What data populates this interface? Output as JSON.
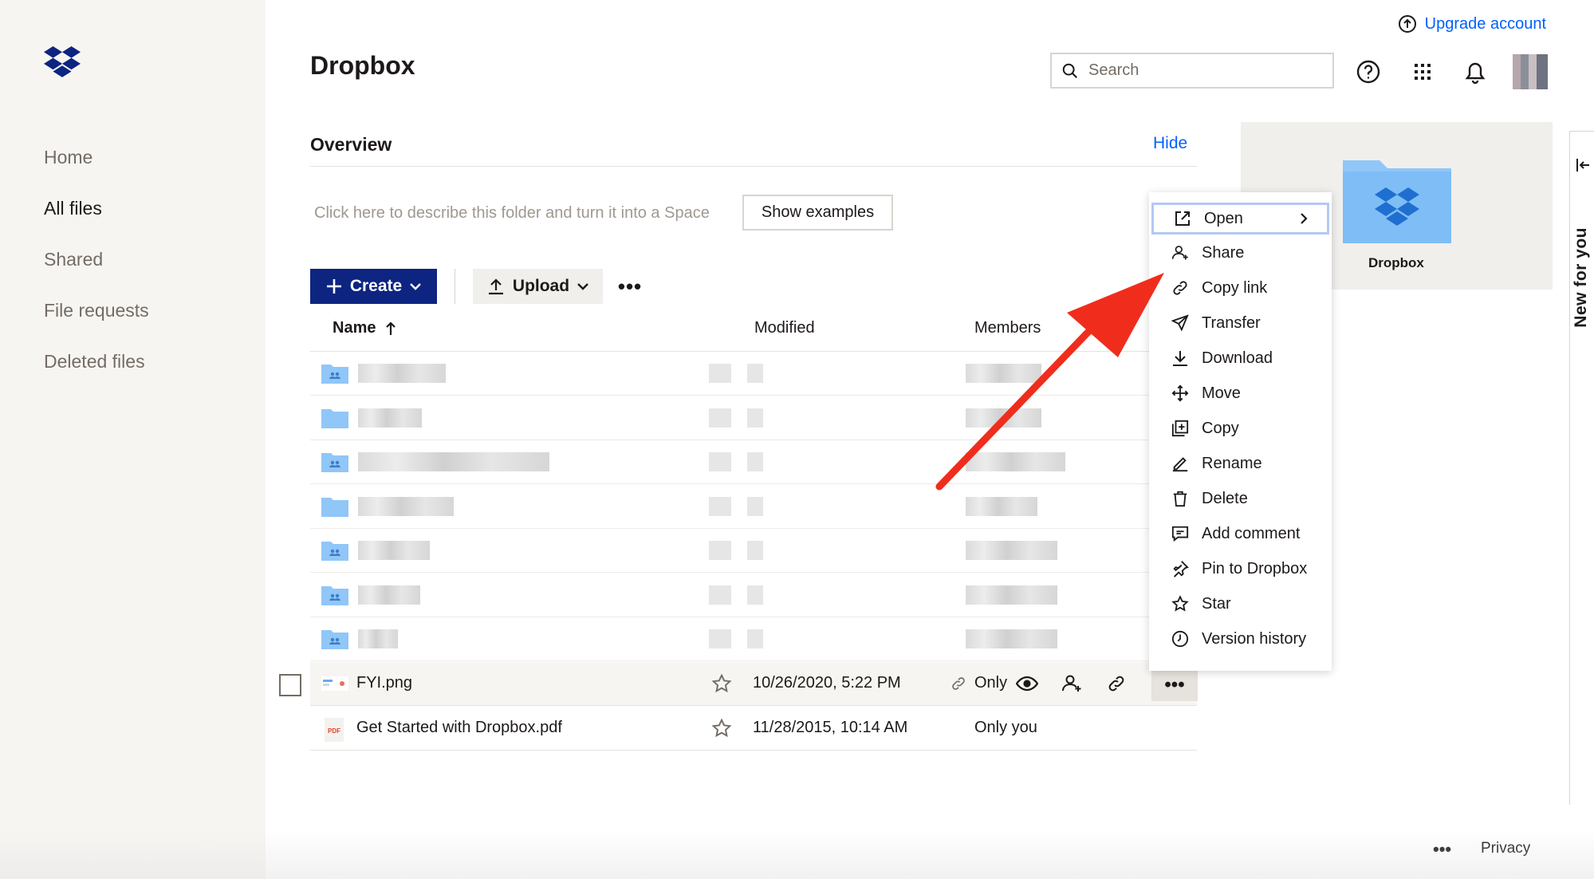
{
  "app": {
    "title": "Dropbox"
  },
  "topbar": {
    "upgrade_label": "Upgrade account",
    "search_placeholder": "Search"
  },
  "sidebar": {
    "items": [
      {
        "label": "Home",
        "active": false
      },
      {
        "label": "All files",
        "active": true
      },
      {
        "label": "Shared",
        "active": false
      },
      {
        "label": "File requests",
        "active": false
      },
      {
        "label": "Deleted files",
        "active": false
      }
    ]
  },
  "overview": {
    "title": "Overview",
    "hide_label": "Hide",
    "describe_text": "Click here to describe this folder and turn it into a Space",
    "show_examples_label": "Show examples"
  },
  "toolbar": {
    "create_label": "Create",
    "upload_label": "Upload",
    "more_label": "•••"
  },
  "table": {
    "columns": {
      "name": "Name",
      "modified": "Modified",
      "members": "Members"
    },
    "files": [
      {
        "name": "FYI.png",
        "modified": "10/26/2020, 5:22 PM",
        "members": "Only",
        "highlighted": true
      },
      {
        "name": "Get Started with Dropbox.pdf",
        "modified": "11/28/2015, 10:14 AM",
        "members": "Only you",
        "highlighted": false
      }
    ],
    "row_more_label": "•••"
  },
  "preview": {
    "folder_label": "Dropbox"
  },
  "context_menu": {
    "items": [
      {
        "label": "Open",
        "icon": "open-external-icon",
        "submenu": true
      },
      {
        "label": "Share",
        "icon": "share-person-icon"
      },
      {
        "label": "Copy link",
        "icon": "link-icon"
      },
      {
        "label": "Transfer",
        "icon": "send-icon"
      },
      {
        "label": "Download",
        "icon": "download-icon"
      },
      {
        "label": "Move",
        "icon": "move-icon"
      },
      {
        "label": "Copy",
        "icon": "copy-icon"
      },
      {
        "label": "Rename",
        "icon": "pencil-icon"
      },
      {
        "label": "Delete",
        "icon": "trash-icon"
      },
      {
        "label": "Add comment",
        "icon": "comment-icon"
      },
      {
        "label": "Pin to Dropbox",
        "icon": "pin-icon"
      },
      {
        "label": "Star",
        "icon": "star-icon"
      },
      {
        "label": "Version history",
        "icon": "clock-icon"
      }
    ]
  },
  "side_panel": {
    "label": "New for you"
  },
  "footer": {
    "more_label": "•••",
    "privacy_label": "Privacy"
  },
  "colors": {
    "brand_blue": "#0061fe",
    "create_navy": "#0d2481",
    "arrow_red": "#f02d1d",
    "folder_blue": "#90c6f8"
  }
}
